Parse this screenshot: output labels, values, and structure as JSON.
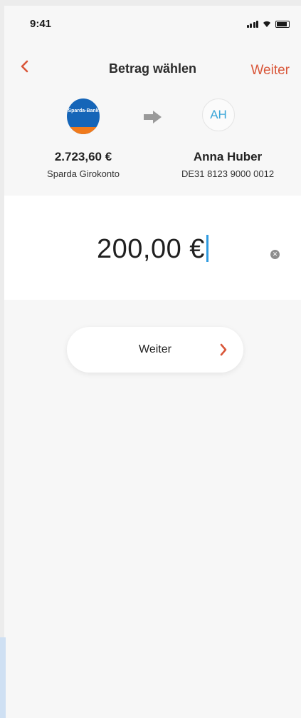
{
  "status_bar": {
    "time": "9:41",
    "icons": [
      "signal-icon",
      "wifi-icon",
      "battery-icon"
    ]
  },
  "nav": {
    "title": "Betrag wählen",
    "next_label": "Weiter",
    "back_icon": "chevron-left-icon"
  },
  "sender": {
    "bank_logo_text": "Sparda-Bank",
    "balance": "2.723,60 €",
    "account_name": "Sparda Girokonto"
  },
  "recipient": {
    "initials": "AH",
    "name": "Anna Huber",
    "iban": "DE31 8123 9000 0012"
  },
  "amount": {
    "value": "200,00 €",
    "clear_icon": "clear-icon"
  },
  "continue_button": {
    "label": "Weiter",
    "icon": "chevron-right-icon"
  },
  "colors": {
    "accent": "#d9573a",
    "caret": "#2f9be0",
    "bank_blue": "#1565b8",
    "bank_orange": "#f07a1c",
    "avatar_text": "#3aa6d8"
  }
}
